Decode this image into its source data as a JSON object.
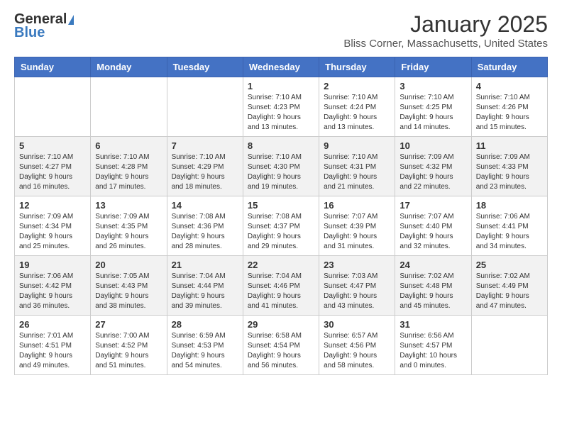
{
  "header": {
    "logo_line1": "General",
    "logo_line2": "Blue",
    "title": "January 2025",
    "subtitle": "Bliss Corner, Massachusetts, United States"
  },
  "days_of_week": [
    "Sunday",
    "Monday",
    "Tuesday",
    "Wednesday",
    "Thursday",
    "Friday",
    "Saturday"
  ],
  "weeks": [
    [
      {
        "day": "",
        "info": ""
      },
      {
        "day": "",
        "info": ""
      },
      {
        "day": "",
        "info": ""
      },
      {
        "day": "1",
        "info": "Sunrise: 7:10 AM\nSunset: 4:23 PM\nDaylight: 9 hours\nand 13 minutes."
      },
      {
        "day": "2",
        "info": "Sunrise: 7:10 AM\nSunset: 4:24 PM\nDaylight: 9 hours\nand 13 minutes."
      },
      {
        "day": "3",
        "info": "Sunrise: 7:10 AM\nSunset: 4:25 PM\nDaylight: 9 hours\nand 14 minutes."
      },
      {
        "day": "4",
        "info": "Sunrise: 7:10 AM\nSunset: 4:26 PM\nDaylight: 9 hours\nand 15 minutes."
      }
    ],
    [
      {
        "day": "5",
        "info": "Sunrise: 7:10 AM\nSunset: 4:27 PM\nDaylight: 9 hours\nand 16 minutes."
      },
      {
        "day": "6",
        "info": "Sunrise: 7:10 AM\nSunset: 4:28 PM\nDaylight: 9 hours\nand 17 minutes."
      },
      {
        "day": "7",
        "info": "Sunrise: 7:10 AM\nSunset: 4:29 PM\nDaylight: 9 hours\nand 18 minutes."
      },
      {
        "day": "8",
        "info": "Sunrise: 7:10 AM\nSunset: 4:30 PM\nDaylight: 9 hours\nand 19 minutes."
      },
      {
        "day": "9",
        "info": "Sunrise: 7:10 AM\nSunset: 4:31 PM\nDaylight: 9 hours\nand 21 minutes."
      },
      {
        "day": "10",
        "info": "Sunrise: 7:09 AM\nSunset: 4:32 PM\nDaylight: 9 hours\nand 22 minutes."
      },
      {
        "day": "11",
        "info": "Sunrise: 7:09 AM\nSunset: 4:33 PM\nDaylight: 9 hours\nand 23 minutes."
      }
    ],
    [
      {
        "day": "12",
        "info": "Sunrise: 7:09 AM\nSunset: 4:34 PM\nDaylight: 9 hours\nand 25 minutes."
      },
      {
        "day": "13",
        "info": "Sunrise: 7:09 AM\nSunset: 4:35 PM\nDaylight: 9 hours\nand 26 minutes."
      },
      {
        "day": "14",
        "info": "Sunrise: 7:08 AM\nSunset: 4:36 PM\nDaylight: 9 hours\nand 28 minutes."
      },
      {
        "day": "15",
        "info": "Sunrise: 7:08 AM\nSunset: 4:37 PM\nDaylight: 9 hours\nand 29 minutes."
      },
      {
        "day": "16",
        "info": "Sunrise: 7:07 AM\nSunset: 4:39 PM\nDaylight: 9 hours\nand 31 minutes."
      },
      {
        "day": "17",
        "info": "Sunrise: 7:07 AM\nSunset: 4:40 PM\nDaylight: 9 hours\nand 32 minutes."
      },
      {
        "day": "18",
        "info": "Sunrise: 7:06 AM\nSunset: 4:41 PM\nDaylight: 9 hours\nand 34 minutes."
      }
    ],
    [
      {
        "day": "19",
        "info": "Sunrise: 7:06 AM\nSunset: 4:42 PM\nDaylight: 9 hours\nand 36 minutes."
      },
      {
        "day": "20",
        "info": "Sunrise: 7:05 AM\nSunset: 4:43 PM\nDaylight: 9 hours\nand 38 minutes."
      },
      {
        "day": "21",
        "info": "Sunrise: 7:04 AM\nSunset: 4:44 PM\nDaylight: 9 hours\nand 39 minutes."
      },
      {
        "day": "22",
        "info": "Sunrise: 7:04 AM\nSunset: 4:46 PM\nDaylight: 9 hours\nand 41 minutes."
      },
      {
        "day": "23",
        "info": "Sunrise: 7:03 AM\nSunset: 4:47 PM\nDaylight: 9 hours\nand 43 minutes."
      },
      {
        "day": "24",
        "info": "Sunrise: 7:02 AM\nSunset: 4:48 PM\nDaylight: 9 hours\nand 45 minutes."
      },
      {
        "day": "25",
        "info": "Sunrise: 7:02 AM\nSunset: 4:49 PM\nDaylight: 9 hours\nand 47 minutes."
      }
    ],
    [
      {
        "day": "26",
        "info": "Sunrise: 7:01 AM\nSunset: 4:51 PM\nDaylight: 9 hours\nand 49 minutes."
      },
      {
        "day": "27",
        "info": "Sunrise: 7:00 AM\nSunset: 4:52 PM\nDaylight: 9 hours\nand 51 minutes."
      },
      {
        "day": "28",
        "info": "Sunrise: 6:59 AM\nSunset: 4:53 PM\nDaylight: 9 hours\nand 54 minutes."
      },
      {
        "day": "29",
        "info": "Sunrise: 6:58 AM\nSunset: 4:54 PM\nDaylight: 9 hours\nand 56 minutes."
      },
      {
        "day": "30",
        "info": "Sunrise: 6:57 AM\nSunset: 4:56 PM\nDaylight: 9 hours\nand 58 minutes."
      },
      {
        "day": "31",
        "info": "Sunrise: 6:56 AM\nSunset: 4:57 PM\nDaylight: 10 hours\nand 0 minutes."
      },
      {
        "day": "",
        "info": ""
      }
    ]
  ],
  "row_styles": [
    "row-white",
    "row-gray",
    "row-white",
    "row-gray",
    "row-white"
  ]
}
